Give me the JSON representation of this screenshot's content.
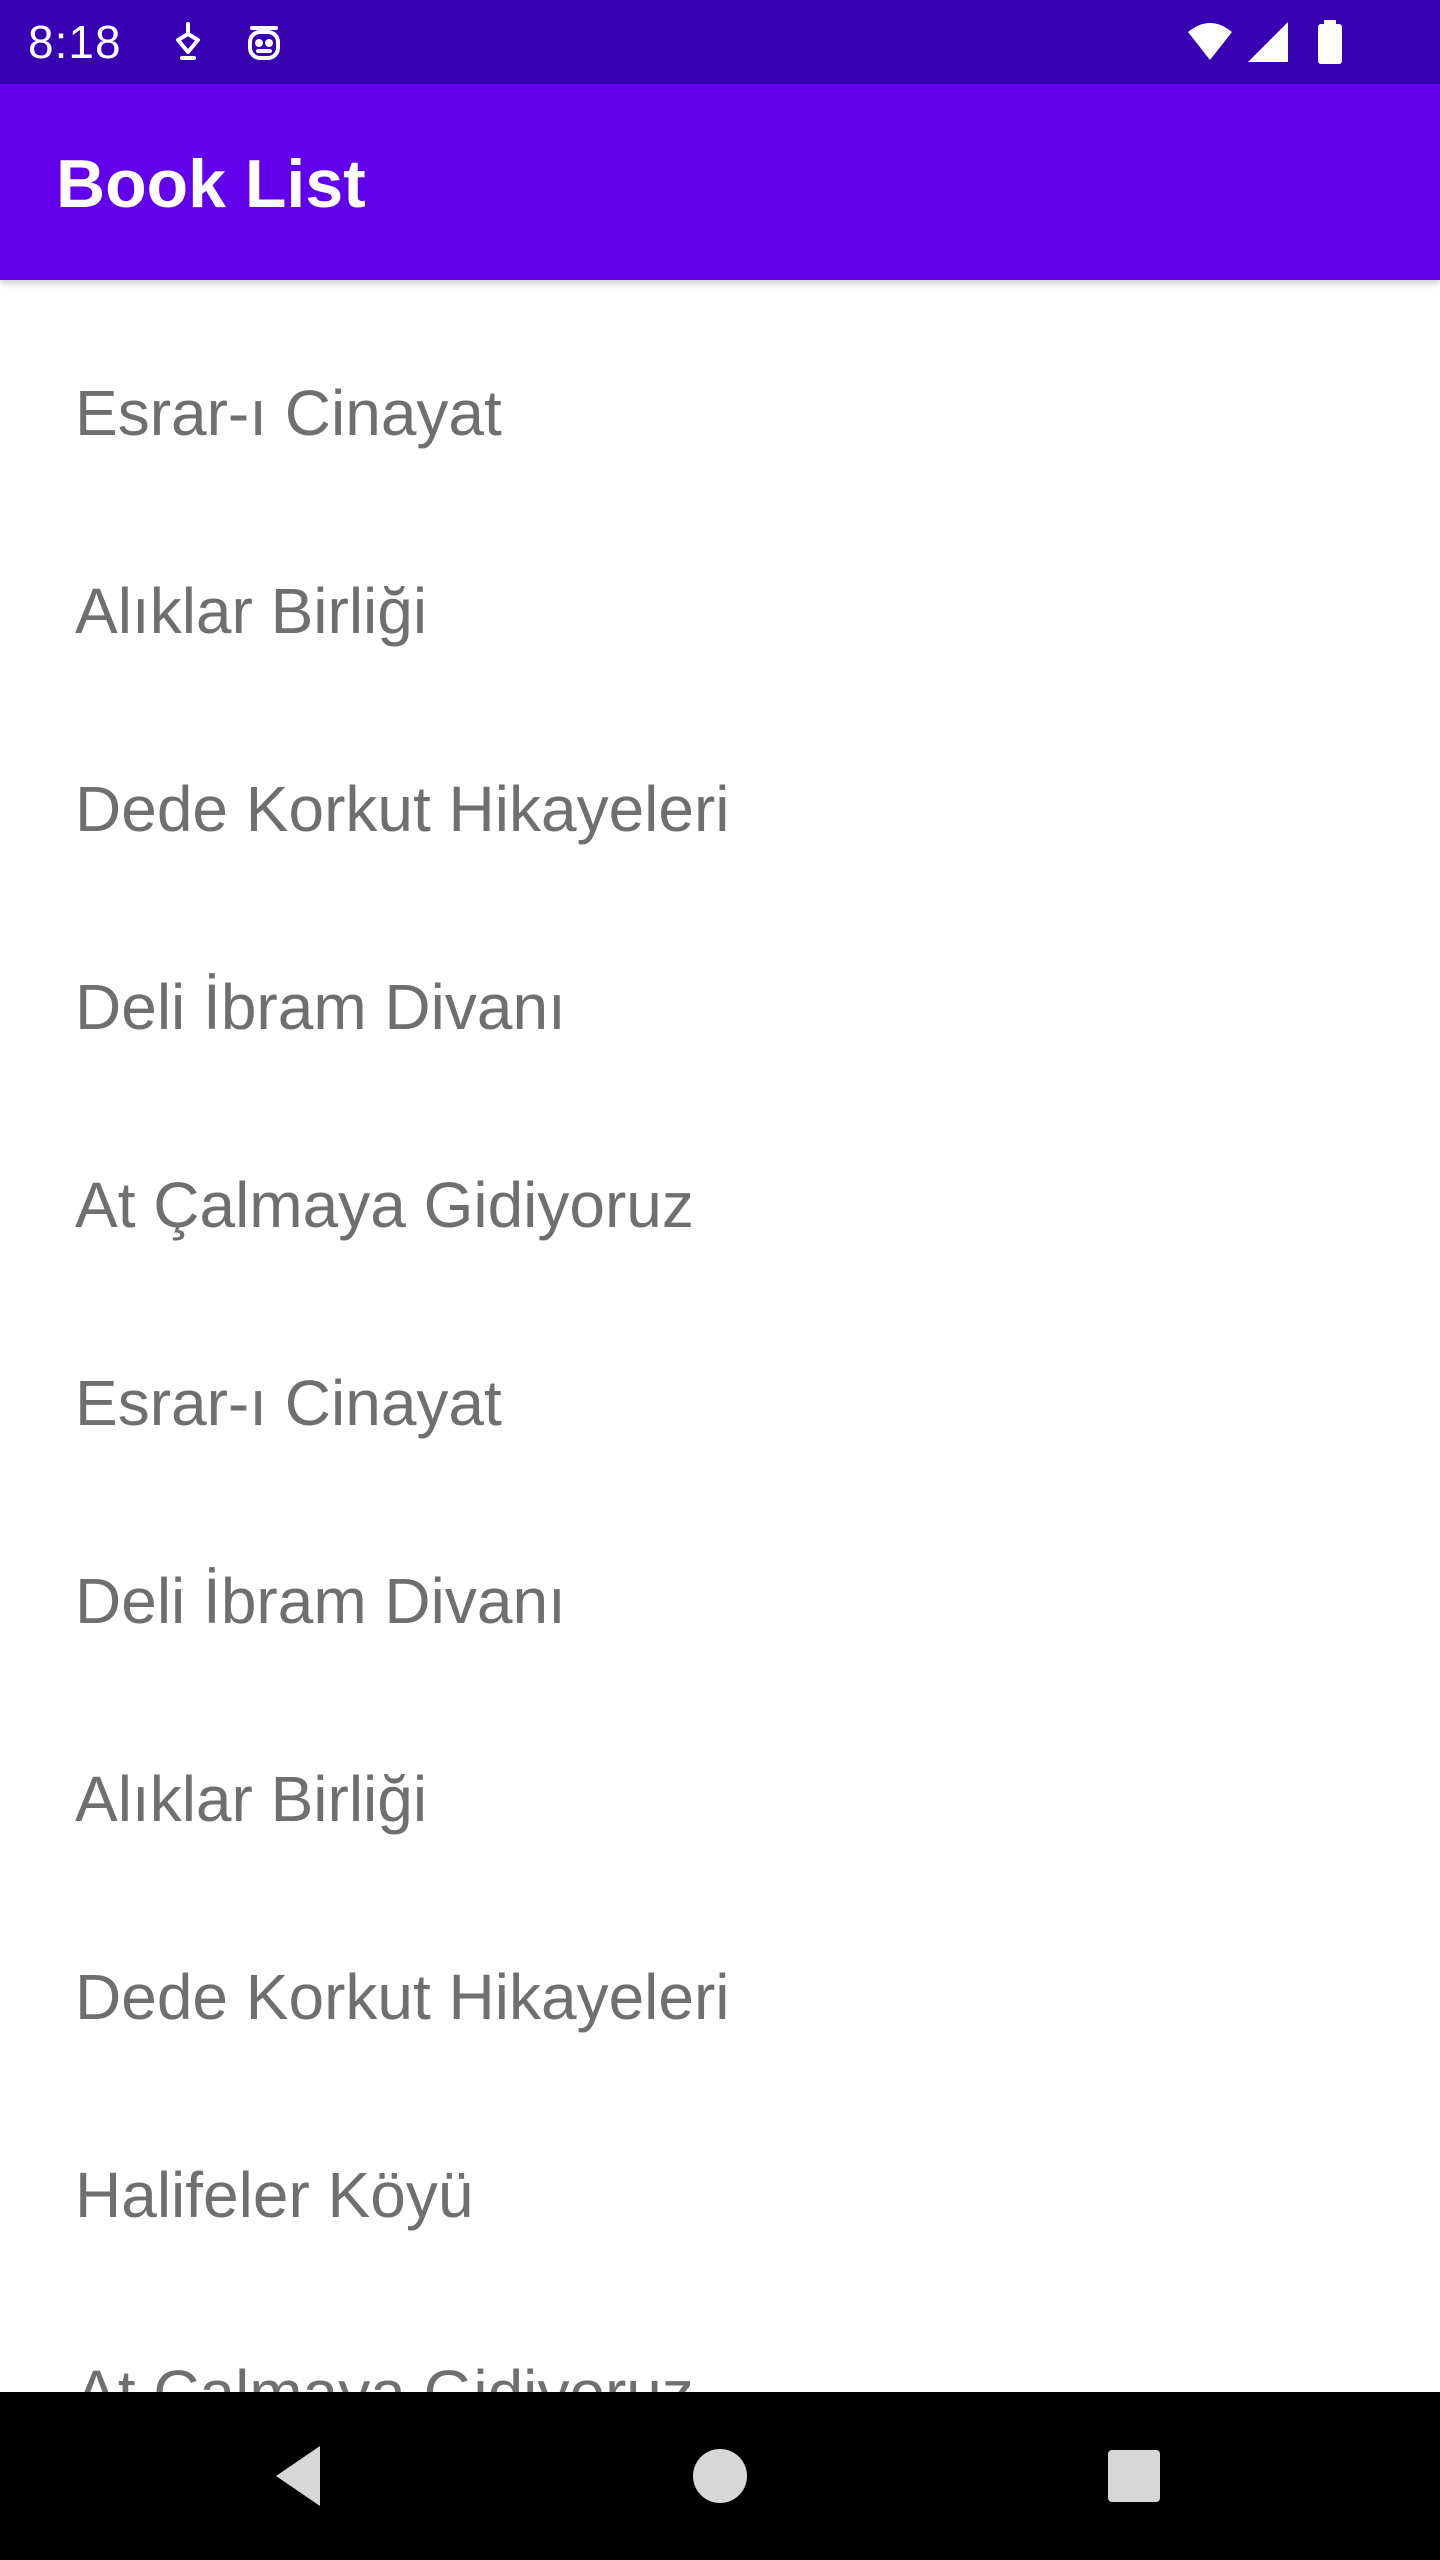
{
  "status_bar": {
    "time": "8:18",
    "icons": [
      "notification-icon",
      "android-icon",
      "wifi-icon",
      "signal-icon",
      "battery-icon"
    ]
  },
  "app_bar": {
    "title": "Book List",
    "color": "#6200ee"
  },
  "colors": {
    "status_bar": "#3700b3",
    "list_text": "#6f6f6f",
    "nav_bar": "#000000"
  },
  "books": [
    "Esrar-ı Cinayat",
    "Alıklar Birliği",
    "Dede Korkut Hikayeleri",
    "Deli İbram Divanı",
    "At Çalmaya Gidiyoruz",
    "Esrar-ı Cinayat",
    "Deli İbram Divanı",
    "Alıklar Birliği",
    "Dede Korkut Hikayeleri",
    "Halifeler Köyü",
    "At Çalmaya Gidiyoruz"
  ],
  "nav_bar": {
    "buttons": [
      "back-icon",
      "home-icon",
      "recents-icon"
    ]
  }
}
